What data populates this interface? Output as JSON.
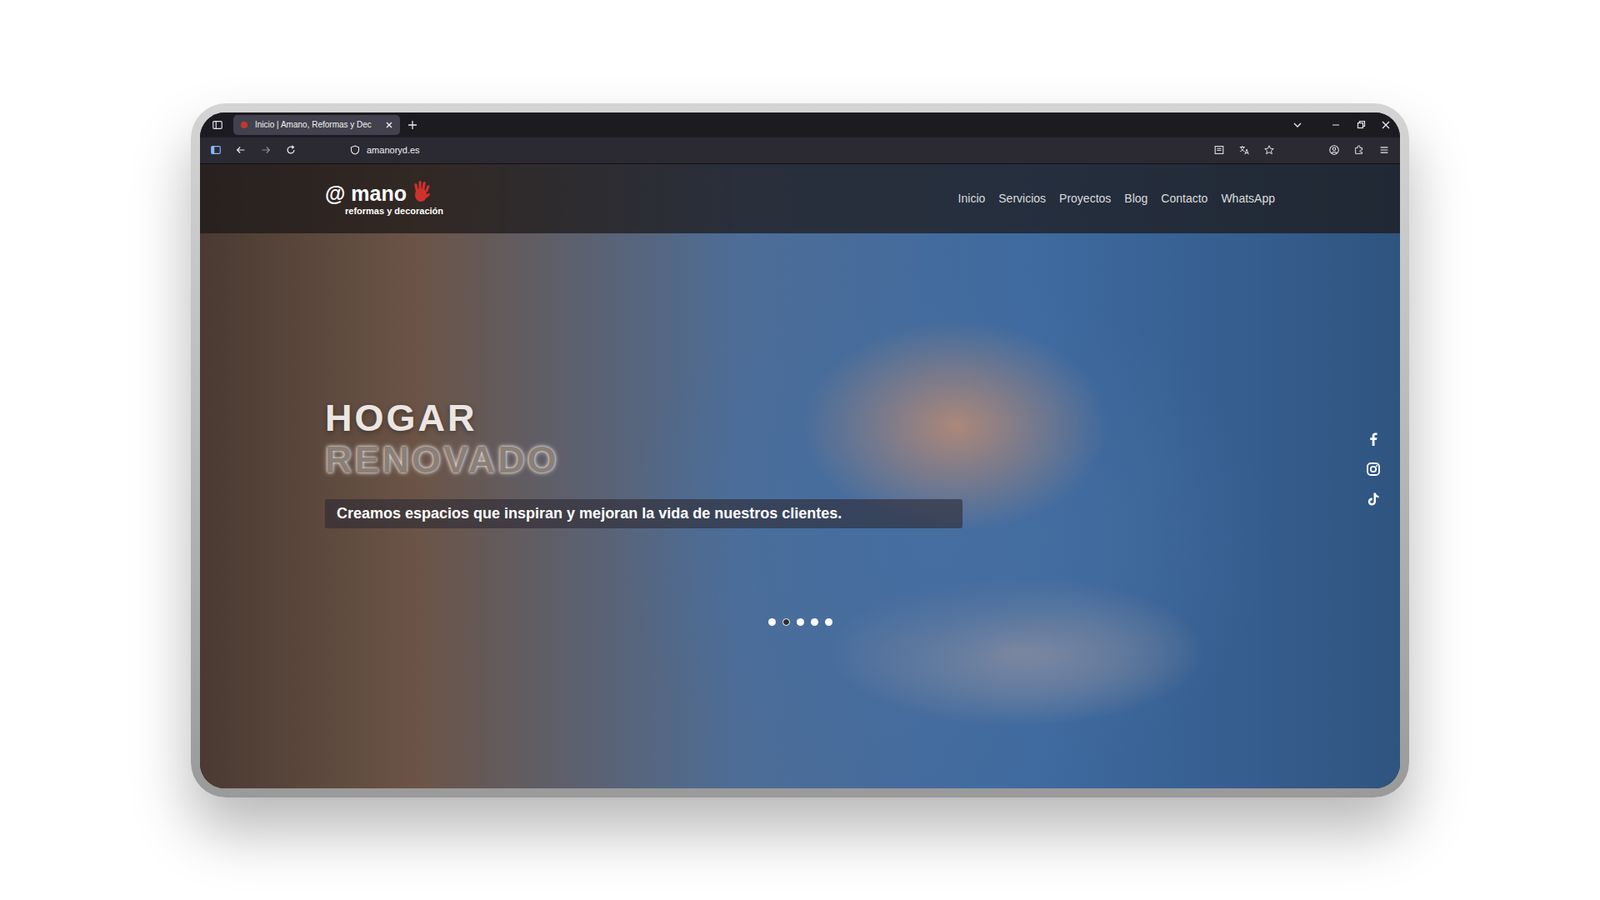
{
  "browser": {
    "tab_title": "Inicio | Amano, Reformas y Dec",
    "address": "amanoryd.es"
  },
  "site": {
    "logo": {
      "name": "@ mano",
      "tagline": "reformas y decoración"
    },
    "nav": [
      {
        "label": "Inicio"
      },
      {
        "label": "Servicios"
      },
      {
        "label": "Proyectos"
      },
      {
        "label": "Blog"
      },
      {
        "label": "Contacto"
      },
      {
        "label": "WhatsApp"
      }
    ],
    "hero": {
      "title_top": "HOGAR",
      "title_bottom": "RENOVADO",
      "subtitle": "Creamos espacios que inspiran y mejoran la vida de nuestros clientes."
    },
    "carousel": {
      "dots": [
        {
          "selected": false
        },
        {
          "selected": true
        },
        {
          "selected": false
        },
        {
          "selected": false
        },
        {
          "selected": false
        }
      ]
    }
  }
}
